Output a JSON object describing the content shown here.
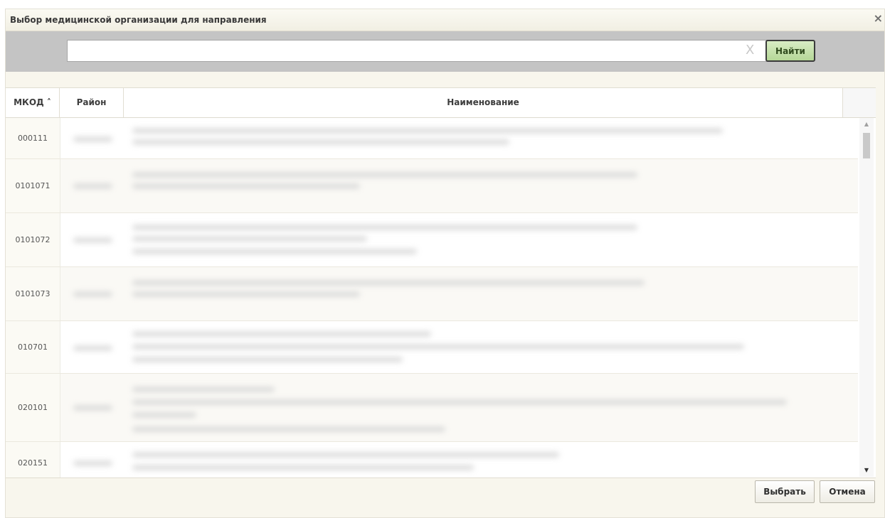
{
  "dialog": {
    "title": "Выбор медицинской организации для направления",
    "close_glyph": "×"
  },
  "search": {
    "value": "",
    "placeholder": "",
    "clear_glyph": "X",
    "find_label": "Найти"
  },
  "table": {
    "columns": {
      "mkod": "МКОД ˄",
      "raion": "Район",
      "name": "Наименование"
    },
    "rows": [
      {
        "mkod": "000111",
        "raion": "",
        "name": ""
      },
      {
        "mkod": "0101071",
        "raion": "",
        "name": ""
      },
      {
        "mkod": "0101072",
        "raion": "",
        "name": ""
      },
      {
        "mkod": "0101073",
        "raion": "",
        "name": ""
      },
      {
        "mkod": "010701",
        "raion": "",
        "name": ""
      },
      {
        "mkod": "020101",
        "raion": "",
        "name": ""
      },
      {
        "mkod": "020151",
        "raion": "",
        "name": ""
      }
    ]
  },
  "footer": {
    "select_label": "Выбрать",
    "cancel_label": "Отмена"
  },
  "icons": {
    "scroll_up": "chevron-up-icon",
    "scroll_down": "chevron-down-icon",
    "close": "close-icon",
    "clear": "clear-icon"
  },
  "colors": {
    "find_button": "#b5d797",
    "search_bar_bg": "#c4c4c4",
    "dialog_bg": "#f8f6ed"
  }
}
